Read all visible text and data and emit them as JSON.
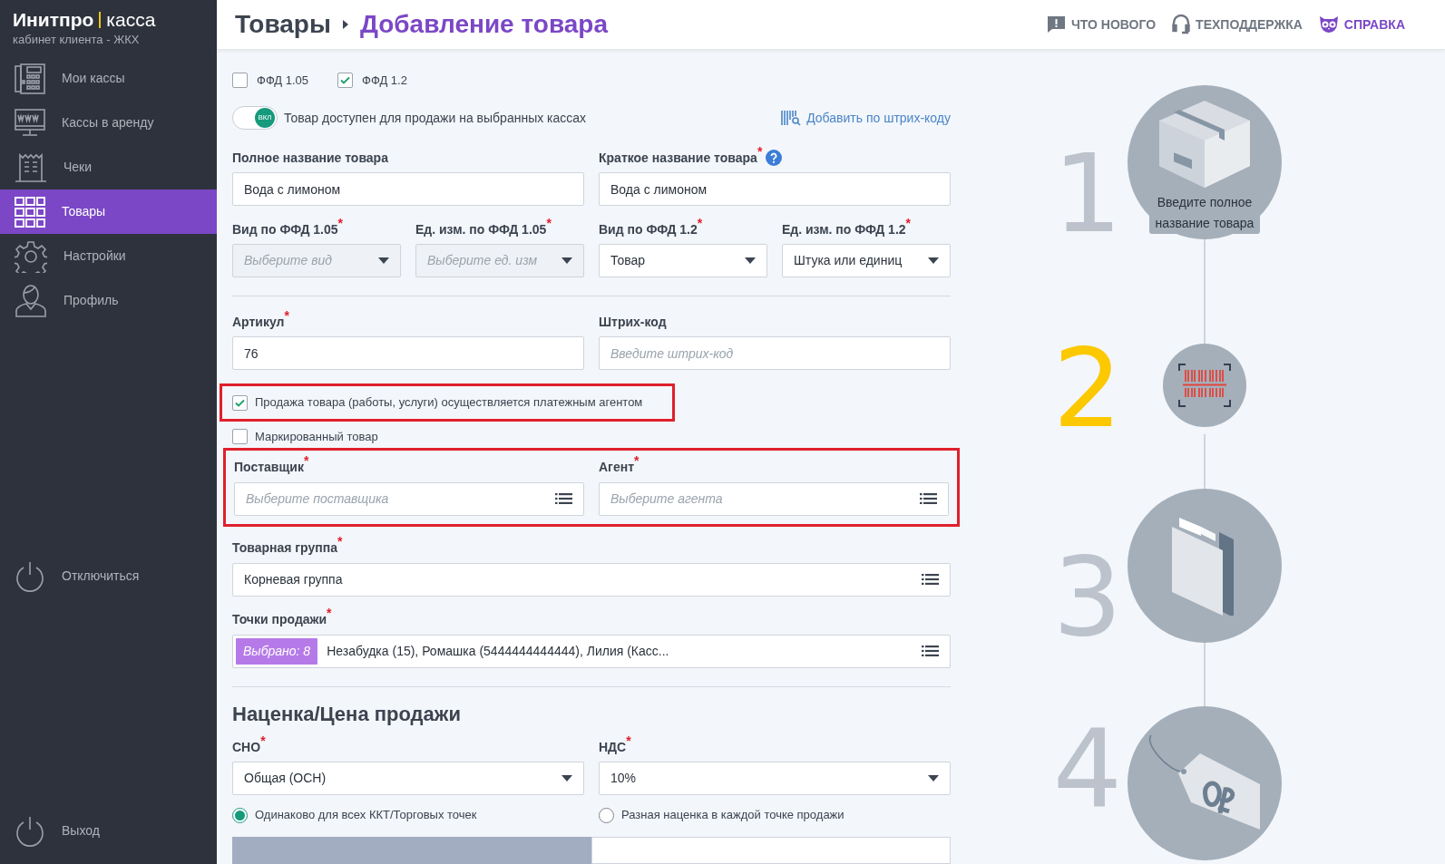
{
  "brand": {
    "name": "Инитпро",
    "product": "касса",
    "subtitle": "кабинет клиента - ЖКХ"
  },
  "sidebar": {
    "items": [
      {
        "label": "Мои кассы",
        "selected": false
      },
      {
        "label": "Кассы в аренду",
        "selected": false
      },
      {
        "label": "Чеки",
        "selected": false
      },
      {
        "label": "Товары",
        "selected": true
      },
      {
        "label": "Настройки",
        "selected": false
      },
      {
        "label": "Профиль",
        "selected": false
      }
    ],
    "bottom_items": [
      {
        "label": "Отключиться"
      },
      {
        "label": "Выход"
      }
    ]
  },
  "header": {
    "breadcrumb": [
      "Товары",
      "Добавление товара"
    ],
    "links": [
      {
        "label": "ЧТО НОВОГО",
        "accent": false
      },
      {
        "label": "ТЕХПОДДЕРЖКА",
        "accent": false
      },
      {
        "label": "СПРАВКА",
        "accent": true
      }
    ]
  },
  "form": {
    "ffd": [
      {
        "label": "ФФД 1.05",
        "checked": false
      },
      {
        "label": "ФФД 1.2",
        "checked": true
      }
    ],
    "toggle": {
      "label": "Товар доступен для продажи на выбранных кассах",
      "on": true,
      "knob": "ВКЛ"
    },
    "barcode_link": "Добавить по штрих-коду",
    "rows": [
      {
        "kind": "fields",
        "fields": [
          {
            "label": "Полное название товара",
            "kind": "text",
            "value": "Вода с лимоном"
          },
          {
            "label": "Краткое название товара$^{*}$",
            "kind": "text",
            "value": "Вода с лимоном",
            "help": true
          }
        ]
      },
      {
        "kind": "fields",
        "fields": [
          {
            "label": "Вид по ФФД 1.05$^{*}$",
            "kind": "select",
            "placeholder": "Выберите вид",
            "disabled": true
          },
          {
            "label": "Ед. изм. по ФФД 1.05$^{*}$",
            "kind": "select",
            "placeholder": "Выберите ед. изм",
            "disabled": true
          },
          {
            "label": "Вид по ФФД 1.2$^{*}$",
            "kind": "select",
            "value": "Товар",
            "disabled": false
          },
          {
            "label": "Ед. изм. по ФФД 1.2$^{*}$",
            "kind": "select",
            "value": "Штука или единиц",
            "disabled": false
          }
        ]
      },
      {
        "kind": "divider"
      },
      {
        "kind": "fields",
        "fields": [
          {
            "label": "Артикул$^{*}$",
            "kind": "text",
            "value": "76"
          },
          {
            "label": "Штрих-код",
            "kind": "text",
            "placeholder": "Введите штрих-код"
          }
        ]
      },
      {
        "kind": "checkbox",
        "label": "Продажа товара (работы, услуги) осуществляется платежным агентом",
        "checked": true,
        "highlighted": true
      },
      {
        "kind": "checkbox",
        "label": "Маркированный товар",
        "checked": false
      },
      {
        "kind": "fields",
        "highlighted": true,
        "fields": [
          {
            "label": "Поставщик$^{*}$",
            "kind": "list",
            "placeholder": "Выберите поставщика"
          },
          {
            "label": "Агент$^{*}$",
            "kind": "list",
            "placeholder": "Выберите агента"
          }
        ]
      },
      {
        "kind": "fields",
        "fields": [
          {
            "label": "Товарная группа$^{*}$",
            "kind": "list",
            "value": "Корневая группа"
          }
        ]
      },
      {
        "kind": "fields",
        "fields": [
          {
            "label": "Точки продажи$^{*}$",
            "kind": "list",
            "badge": "Выбрано: 8",
            "value": "Незабудка (15), Ромашка (5444444444444), Лилия (Касс..."
          }
        ]
      },
      {
        "kind": "divider"
      },
      {
        "kind": "heading",
        "label": "Наценка/Цена продажи"
      },
      {
        "kind": "fields",
        "fields": [
          {
            "label": "СНО$^{*}$",
            "kind": "select",
            "value": "Общая (ОСН)",
            "disabled": false
          },
          {
            "label": "НДС$^{*}$",
            "kind": "select",
            "value": "10%",
            "disabled": false
          }
        ]
      },
      {
        "kind": "radios",
        "options": [
          {
            "label": "Одинаково для всех ККТ/Торговых точек",
            "selected": true
          },
          {
            "label": "Разная наценка в каждой точке продажи",
            "selected": false
          }
        ]
      },
      {
        "kind": "tabs",
        "tabs": [
          {
            "selected": true
          },
          {
            "selected": false
          }
        ]
      }
    ]
  },
  "steps": [
    {
      "number": "1",
      "active": false,
      "caption": "Введите полное название товара"
    },
    {
      "number": "2",
      "active": true
    },
    {
      "number": "3",
      "active": false
    },
    {
      "number": "4",
      "active": false
    }
  ]
}
